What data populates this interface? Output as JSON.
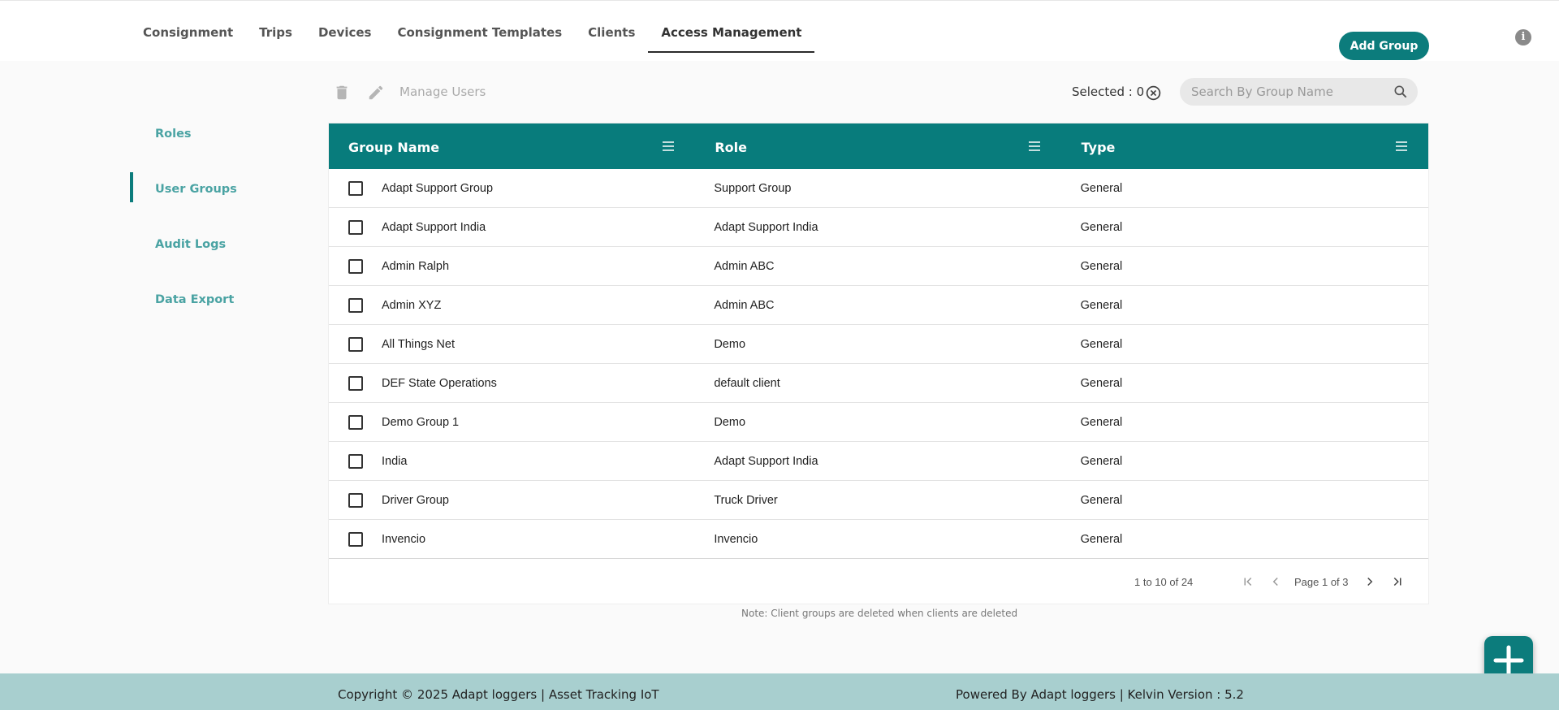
{
  "nav": {
    "tabs": [
      {
        "label": "Consignment"
      },
      {
        "label": "Trips"
      },
      {
        "label": "Devices"
      },
      {
        "label": "Consignment Templates"
      },
      {
        "label": "Clients"
      },
      {
        "label": "Access Management"
      }
    ],
    "active_tab": "Access Management"
  },
  "header": {
    "add_group_label": "Add Group",
    "info_icon": "info-icon"
  },
  "sidebar": {
    "items": [
      {
        "label": "Roles"
      },
      {
        "label": "User Groups"
      },
      {
        "label": "Audit Logs"
      },
      {
        "label": "Data Export"
      }
    ],
    "active_item": "User Groups"
  },
  "toolbar": {
    "delete_icon": "trash-icon",
    "edit_icon": "pencil-icon",
    "manage_users_label": "Manage Users",
    "selected_label": "Selected : 0",
    "search_placeholder": "Search By Group Name"
  },
  "table": {
    "columns": [
      "Group Name",
      "Role",
      "Type"
    ],
    "rows": [
      {
        "group": "Adapt Support Group",
        "role": "Support Group",
        "type": "General"
      },
      {
        "group": "Adapt Support India",
        "role": "Adapt Support India",
        "type": "General"
      },
      {
        "group": "Admin Ralph",
        "role": "Admin ABC",
        "type": "General"
      },
      {
        "group": "Admin XYZ",
        "role": "Admin ABC",
        "type": "General"
      },
      {
        "group": "All Things Net",
        "role": "Demo",
        "type": "General"
      },
      {
        "group": "DEF State Operations",
        "role": "default client",
        "type": "General"
      },
      {
        "group": "Demo Group 1",
        "role": "Demo",
        "type": "General"
      },
      {
        "group": "India",
        "role": "Adapt Support India",
        "type": "General"
      },
      {
        "group": "Driver Group",
        "role": "Truck Driver",
        "type": "General"
      },
      {
        "group": "Invencio",
        "role": "Invencio",
        "type": "General"
      }
    ]
  },
  "pagination": {
    "range": "1 to 10 of 24",
    "page_text": "Page 1 of 3"
  },
  "note": "Note: Client groups are deleted when clients are deleted",
  "footer": {
    "copyright": "Copyright © 2025 Adapt loggers | Asset Tracking IoT",
    "powered": "Powered By Adapt loggers | Kelvin Version : 5.2"
  },
  "colors": {
    "accent": "#0c7c7c",
    "sidebar_text": "#4aa3a3",
    "footer_bg": "#a8cfcf"
  }
}
